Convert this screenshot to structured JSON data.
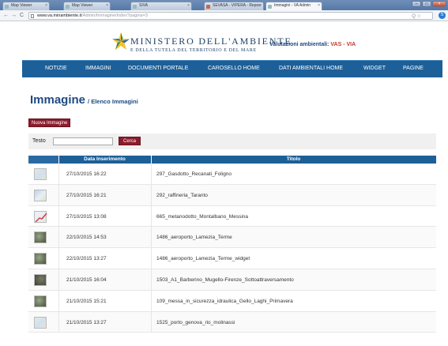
{
  "browser": {
    "tabs": [
      {
        "label": "Map Viewer",
        "active": false
      },
      {
        "label": "Map Viewer",
        "active": false
      },
      {
        "label": "SIVA",
        "active": false
      },
      {
        "label": "SEVASA - VIPERA - Repos",
        "active": false
      },
      {
        "label": "Immagini - VA Admin",
        "active": true
      }
    ],
    "url_host": "www.va.minambiente.it",
    "url_path": "/Admin/Immagine/Index?pagina=3",
    "url_icons": "Q ☆"
  },
  "header": {
    "ministry_line1": "MINISTERO DELL'AMBIENTE",
    "ministry_line2": "E DELLA TUTELA DEL TERRITORIO E DEL MARE",
    "portal_title": "Valutazioni ambientali: ",
    "portal_accent": "VAS - VIA"
  },
  "nav": {
    "items": [
      "NOTIZIE",
      "IMMAGINI",
      "DOCUMENTI PORTALE",
      "CAROSELLO HOME",
      "DATI AMBIENTALI HOME",
      "WIDGET",
      "PAGINE"
    ]
  },
  "page": {
    "title": "Immagine",
    "subtitle": "/ Elenco Immagini",
    "new_button": "Nuova Immagine",
    "filter_label": "Testo",
    "filter_value": "",
    "search_button": "Cerca"
  },
  "table": {
    "columns": [
      "Data Inserimento",
      "Titolo"
    ],
    "rows": [
      {
        "date": "27/10/2015 16:22",
        "title": "297_Gasdotto_Recanati_Foligno",
        "thumb": "map-light"
      },
      {
        "date": "27/10/2015 16:21",
        "title": "292_raffineria_Taranto",
        "thumb": "map-blue"
      },
      {
        "date": "27/10/2015 13:08",
        "title": "665_metanodotto_Montalbano_Messina",
        "thumb": "map-route"
      },
      {
        "date": "22/10/2015 14:53",
        "title": "1486_aeroporto_Lamezia_Terme",
        "thumb": "aerial-green"
      },
      {
        "date": "22/10/2015 13:27",
        "title": "1486_aeroporto_Lamezia_Terme_widget",
        "thumb": "aerial-green"
      },
      {
        "date": "21/10/2015 16:04",
        "title": "1503_A1_Barberino_Mugello-Firenze_Sottoattraversamento",
        "thumb": "aerial-dark"
      },
      {
        "date": "21/10/2015 15:21",
        "title": "109_messa_in_sicurezza_idraulica_Gello_Laghi_Primavera",
        "thumb": "aerial-green"
      },
      {
        "date": "21/10/2015 13:27",
        "title": "1525_porto_genova_rio_molinassi",
        "thumb": "map-light"
      }
    ]
  },
  "colors": {
    "nav_blue": "#1d5f98",
    "button_red": "#8b1c2c",
    "title_blue": "#1e4a82"
  }
}
